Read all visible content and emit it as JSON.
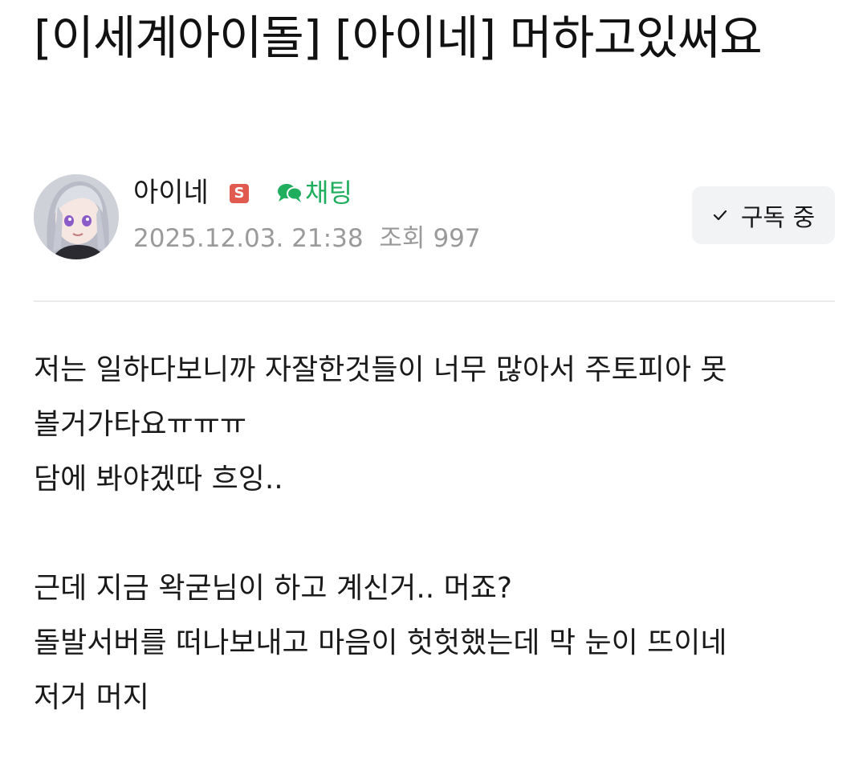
{
  "post": {
    "title": "[이세계아이돌] [아이네] 머하고있써요"
  },
  "author": {
    "name": "아이네",
    "badge": "S",
    "chat_label": "채팅",
    "date": "2025.12.03. 21:38",
    "views_label": "조회",
    "views": "997",
    "subscribe_label": "구독 중"
  },
  "icons": {
    "chat": "chat-bubbles-icon",
    "subscribed": "check-icon"
  },
  "colors": {
    "chat_green": "#1fae5e",
    "badge_red": "#e05a4f",
    "meta_gray": "#9a9a9a",
    "button_bg": "#f2f3f5"
  },
  "content": {
    "lines": [
      "저는 일하다보니까 자잘한것들이 너무 많아서 주토피아 못",
      "볼거가타요ㅠㅠㅠ",
      "담에 봐야겠따 흐잉..",
      "",
      "근데 지금 왁굳님이 하고 계신거.. 머죠?",
      "돌발서버를 떠나보내고 마음이 헛헛했는데 막 눈이 뜨이네",
      "저거 머지"
    ]
  }
}
